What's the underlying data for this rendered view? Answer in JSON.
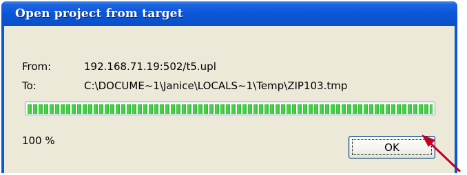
{
  "window": {
    "title": "Open project from target"
  },
  "fields": {
    "from_label": "From:",
    "from_value": "192.168.71.19:502/t5.upl",
    "to_label": "To:",
    "to_value": "C:\\DOCUME~1\\Janice\\LOCALS~1\\Temp\\ZIP103.tmp"
  },
  "progress": {
    "value": 1.0,
    "percent_text": "100 %",
    "color": "#2fbc2f"
  },
  "buttons": {
    "ok_label": "OK"
  },
  "annotation": {
    "arrow_color": "#c0001e"
  },
  "colors": {
    "titlebar": "#0a57d8",
    "client": "#ece9d8"
  }
}
